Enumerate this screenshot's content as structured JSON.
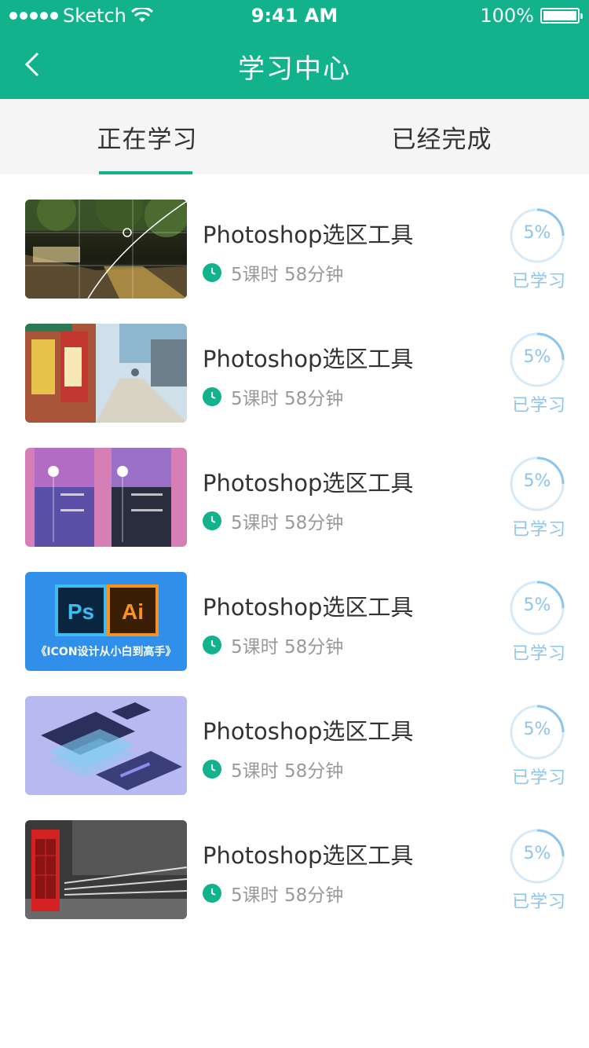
{
  "status_bar": {
    "carrier": "Sketch",
    "time": "9:41 AM",
    "battery": "100%"
  },
  "nav": {
    "title": "学习中心"
  },
  "tabs": [
    {
      "label": "正在学习",
      "active": true
    },
    {
      "label": "已经完成",
      "active": false
    }
  ],
  "colors": {
    "primary": "#12b28c",
    "progress": "#8ec5ec"
  },
  "courses": [
    {
      "thumbnail": "night-street-photo",
      "title": "Photoshop选区工具",
      "meta": "5课时  58分钟",
      "progress_label": "5%",
      "progress": 0.05,
      "status": "已学习"
    },
    {
      "thumbnail": "japanese-street-photo",
      "title": "Photoshop选区工具",
      "meta": "5课时  58分钟",
      "progress_label": "5%",
      "progress": 0.05,
      "status": "已学习"
    },
    {
      "thumbnail": "weather-app-screens",
      "title": "Photoshop选区工具",
      "meta": "5课时  58分钟",
      "progress_label": "5%",
      "progress": 0.05,
      "status": "已学习"
    },
    {
      "thumbnail": "ps-ai-icon-banner",
      "title": "Photoshop选区工具",
      "meta": "5课时  58分钟",
      "progress_label": "5%",
      "progress": 0.05,
      "status": "已学习"
    },
    {
      "thumbnail": "isometric-layers",
      "title": "Photoshop选区工具",
      "meta": "5课时  58分钟",
      "progress_label": "5%",
      "progress": 0.05,
      "status": "已学习"
    },
    {
      "thumbnail": "red-phone-booth",
      "title": "Photoshop选区工具",
      "meta": "5课时  58分钟",
      "progress_label": "5%",
      "progress": 0.05,
      "status": "已学习"
    }
  ],
  "thumbnail_texts": {
    "ps": "Ps",
    "ai": "Ai",
    "banner": "《ICON设计从小白到高手》"
  }
}
